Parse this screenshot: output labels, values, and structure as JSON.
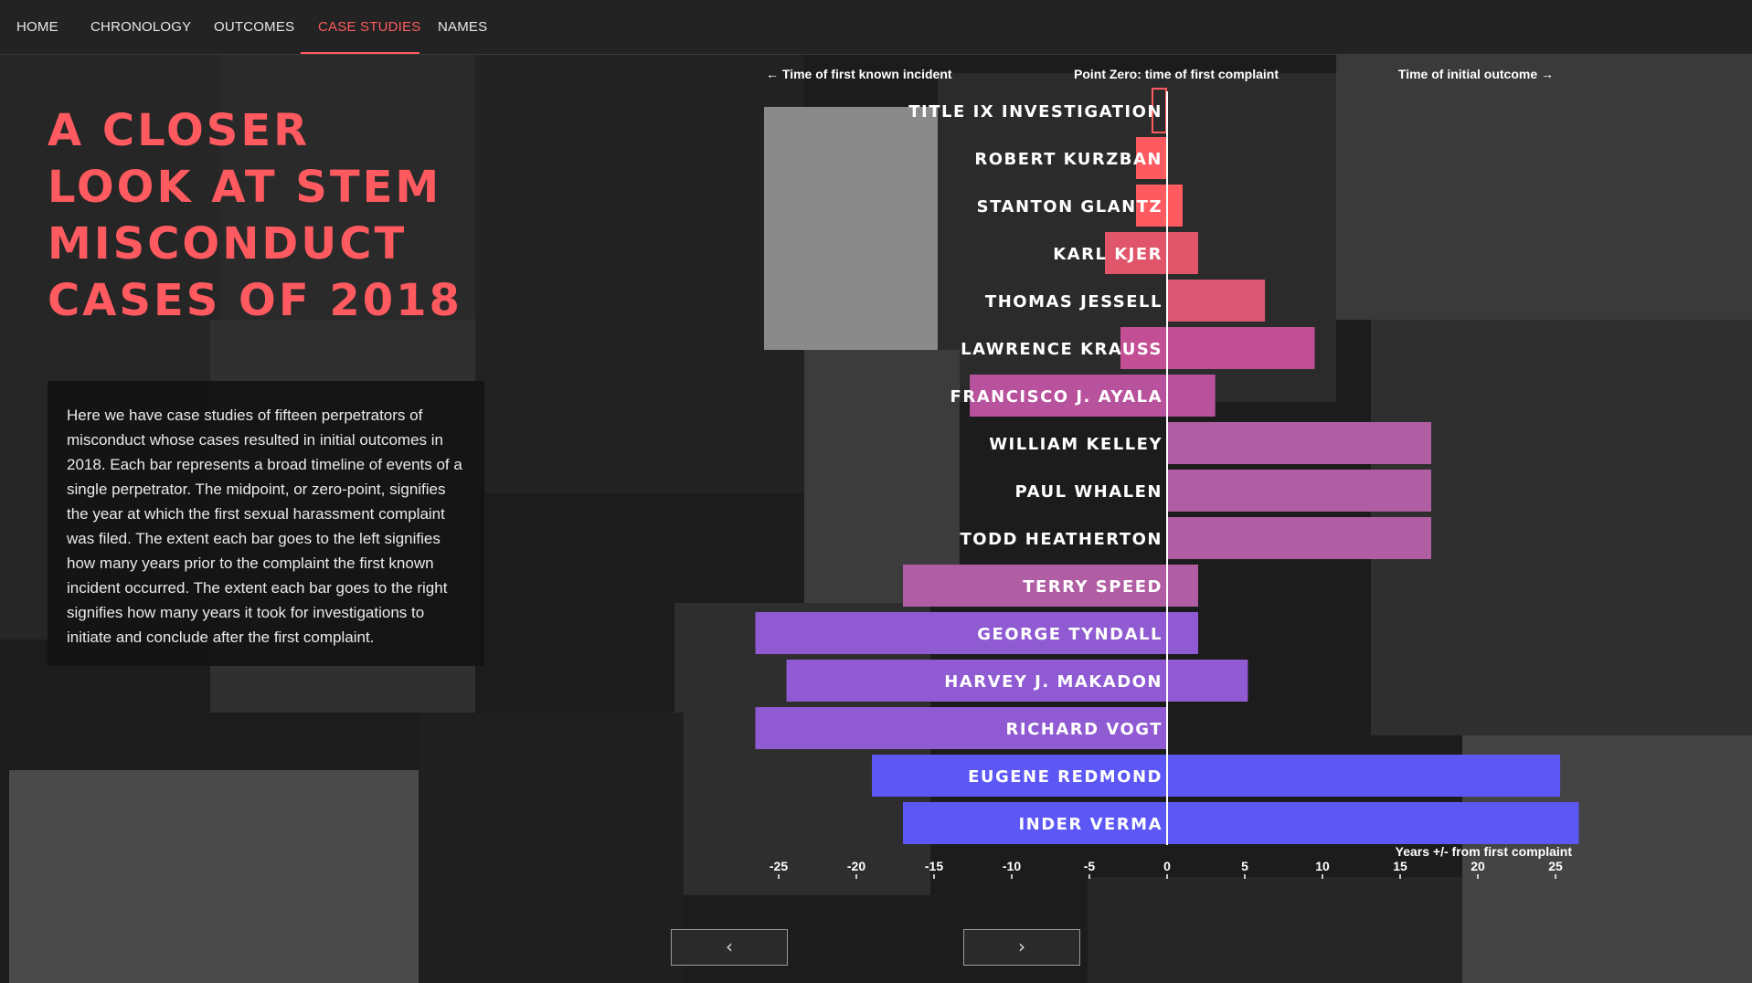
{
  "nav": {
    "items": [
      "HOME",
      "CHRONOLOGY",
      "OUTCOMES",
      "CASE STUDIES",
      "NAMES"
    ],
    "active": "CASE STUDIES",
    "active_color": "#ff5a5f"
  },
  "title_lines": [
    "A CLOSER",
    "LOOK AT STEM",
    "MISCONDUCT",
    "CASES OF 2018"
  ],
  "description": "Here we have case studies of fifteen perpetrators of misconduct whose cases resulted in initial outcomes in 2018. Each bar represents a broad timeline of events of a single perpetrator. The midpoint, or zero-point, signifies the year at which the first sexual harassment complaint was filed. The extent each bar goes to the left signifies how many years prior to the complaint the first known incident occurred. The extent each bar goes to the right signifies how many years it took for investigations to initiate and conclude after the first complaint.",
  "buttons": {
    "prev": "‹",
    "next": "›"
  },
  "chart_data": {
    "type": "bar",
    "orientation": "horizontal-diverging",
    "header_left": "← Time of first known incident",
    "header_center": "Point Zero: time of first complaint",
    "header_right": "Time of initial outcome →",
    "xlabel": "Years +/- from first complaint",
    "xlim": [
      -26,
      27
    ],
    "xticks": [
      -25,
      -20,
      -15,
      -10,
      -5,
      0,
      5,
      10,
      15,
      20,
      25
    ],
    "rows": [
      {
        "name": "TITLE IX INVESTIGATION",
        "start": -1,
        "end": 0,
        "color": "#ff5a5f",
        "outline": true
      },
      {
        "name": "ROBERT KURZBAN",
        "start": -2,
        "end": 0,
        "color": "#ff5a5f"
      },
      {
        "name": "STANTON GLANTZ",
        "start": -2,
        "end": 1,
        "color": "#ff5a5f"
      },
      {
        "name": "KARL KJER",
        "start": -4,
        "end": 2,
        "color": "#e0556a"
      },
      {
        "name": "THOMAS JESSELL",
        "start": 0,
        "end": 6.3,
        "color": "#d95772"
      },
      {
        "name": "LAWRENCE KRAUSS",
        "start": -3,
        "end": 9.5,
        "color": "#c24f94"
      },
      {
        "name": "FRANCISCO J. AYALA",
        "start": -12.7,
        "end": 3.1,
        "color": "#b9529d"
      },
      {
        "name": "WILLIAM KELLEY",
        "start": 0,
        "end": 17,
        "color": "#b15da3"
      },
      {
        "name": "PAUL WHALEN",
        "start": 0,
        "end": 17,
        "color": "#b15da3"
      },
      {
        "name": "TODD HEATHERTON",
        "start": 0,
        "end": 17,
        "color": "#b15da3"
      },
      {
        "name": "TERRY SPEED",
        "start": -17,
        "end": 2,
        "color": "#b15da3"
      },
      {
        "name": "GEORGE TYNDALL",
        "start": -26.5,
        "end": 2,
        "color": "#8f5ad2"
      },
      {
        "name": "HARVEY J. MAKADON",
        "start": -24.5,
        "end": 5.2,
        "color": "#8f5ad2"
      },
      {
        "name": "RICHARD VOGT",
        "start": -26.5,
        "end": 0,
        "color": "#8f5ad2"
      },
      {
        "name": "EUGENE REDMOND",
        "start": -19,
        "end": 25.3,
        "color": "#5c57f5"
      },
      {
        "name": "INDER VERMA",
        "start": -17,
        "end": 26.5,
        "color": "#5c57f5"
      }
    ]
  }
}
